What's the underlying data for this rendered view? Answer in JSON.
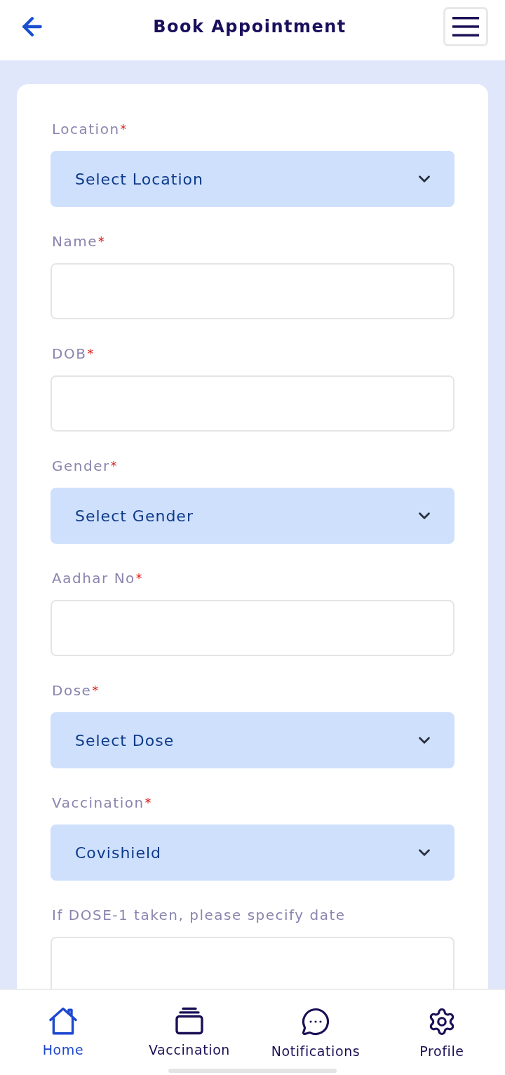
{
  "header": {
    "title": "Book Appointment"
  },
  "form": {
    "fields": [
      {
        "kind": "select",
        "label": "Location",
        "required_mark": "*",
        "value": "Select Location"
      },
      {
        "kind": "input",
        "label": "Name",
        "required_mark": "*"
      },
      {
        "kind": "input",
        "label": "DOB",
        "required_mark": "*"
      },
      {
        "kind": "select",
        "label": "Gender",
        "required_mark": "*",
        "value": "Select Gender"
      },
      {
        "kind": "input",
        "label": "Aadhar No",
        "required_mark": "*"
      },
      {
        "kind": "select",
        "label": "Dose",
        "required_mark": "*",
        "value": "Select Dose"
      },
      {
        "kind": "select",
        "label": "Vaccination",
        "required_mark": "*",
        "value": "Covishield"
      },
      {
        "kind": "input",
        "label": "If DOSE-1 taken, please specify date"
      }
    ]
  },
  "nav": {
    "items": [
      {
        "label": "Home",
        "selected": true
      },
      {
        "label": "Vaccination",
        "selected": false
      },
      {
        "label": "Notifications",
        "selected": false
      },
      {
        "label": "Profile",
        "selected": false
      }
    ]
  }
}
